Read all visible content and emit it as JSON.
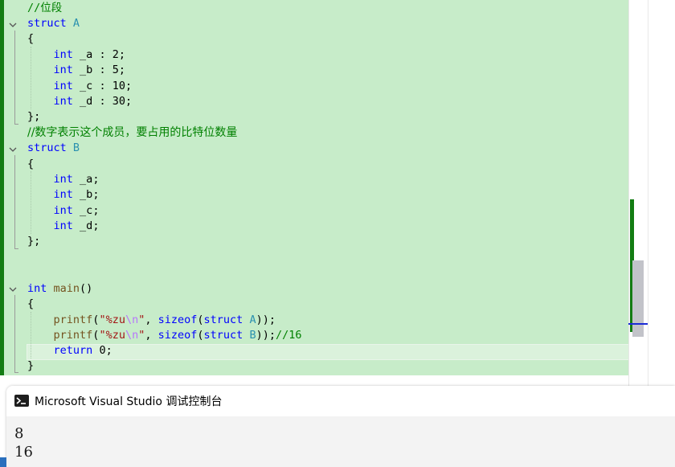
{
  "editor": {
    "comment_bitfield": "//位段",
    "struct_kw": "struct",
    "struct_a": "A",
    "struct_b": "B",
    "open_brace": "{",
    "close_brace_semi": "};",
    "close_brace": "}",
    "int_kw": "int",
    "a_members": [
      {
        "name": "_a",
        "bits": "2"
      },
      {
        "name": "_b",
        "bits": "5"
      },
      {
        "name": "_c",
        "bits": "10"
      },
      {
        "name": "_d",
        "bits": "30"
      }
    ],
    "b_members": [
      "_a",
      "_b",
      "_c",
      "_d"
    ],
    "comment_explain": "//数字表示这个成员，要占用的比特位数量",
    "main_name": "main",
    "printf_name": "printf",
    "format_prefix": "\"%zu",
    "format_escape": "\\n",
    "format_suffix": "\"",
    "sizeof_kw": "sizeof",
    "comment_16": "//16",
    "return_kw": "return",
    "return_value": "0"
  },
  "console": {
    "title": "Microsoft Visual Studio 调试控制台",
    "output_lines": [
      "8",
      "16"
    ]
  },
  "colors": {
    "editor_bg": "#c7ecc9",
    "change_bar": "#137c13",
    "keyword": "#0000ff",
    "type_name": "#2b91af",
    "comment": "#008000",
    "string": "#a31515",
    "escape": "#b776fb",
    "function": "#74531f",
    "caret_marker": "#1b2bd6"
  }
}
